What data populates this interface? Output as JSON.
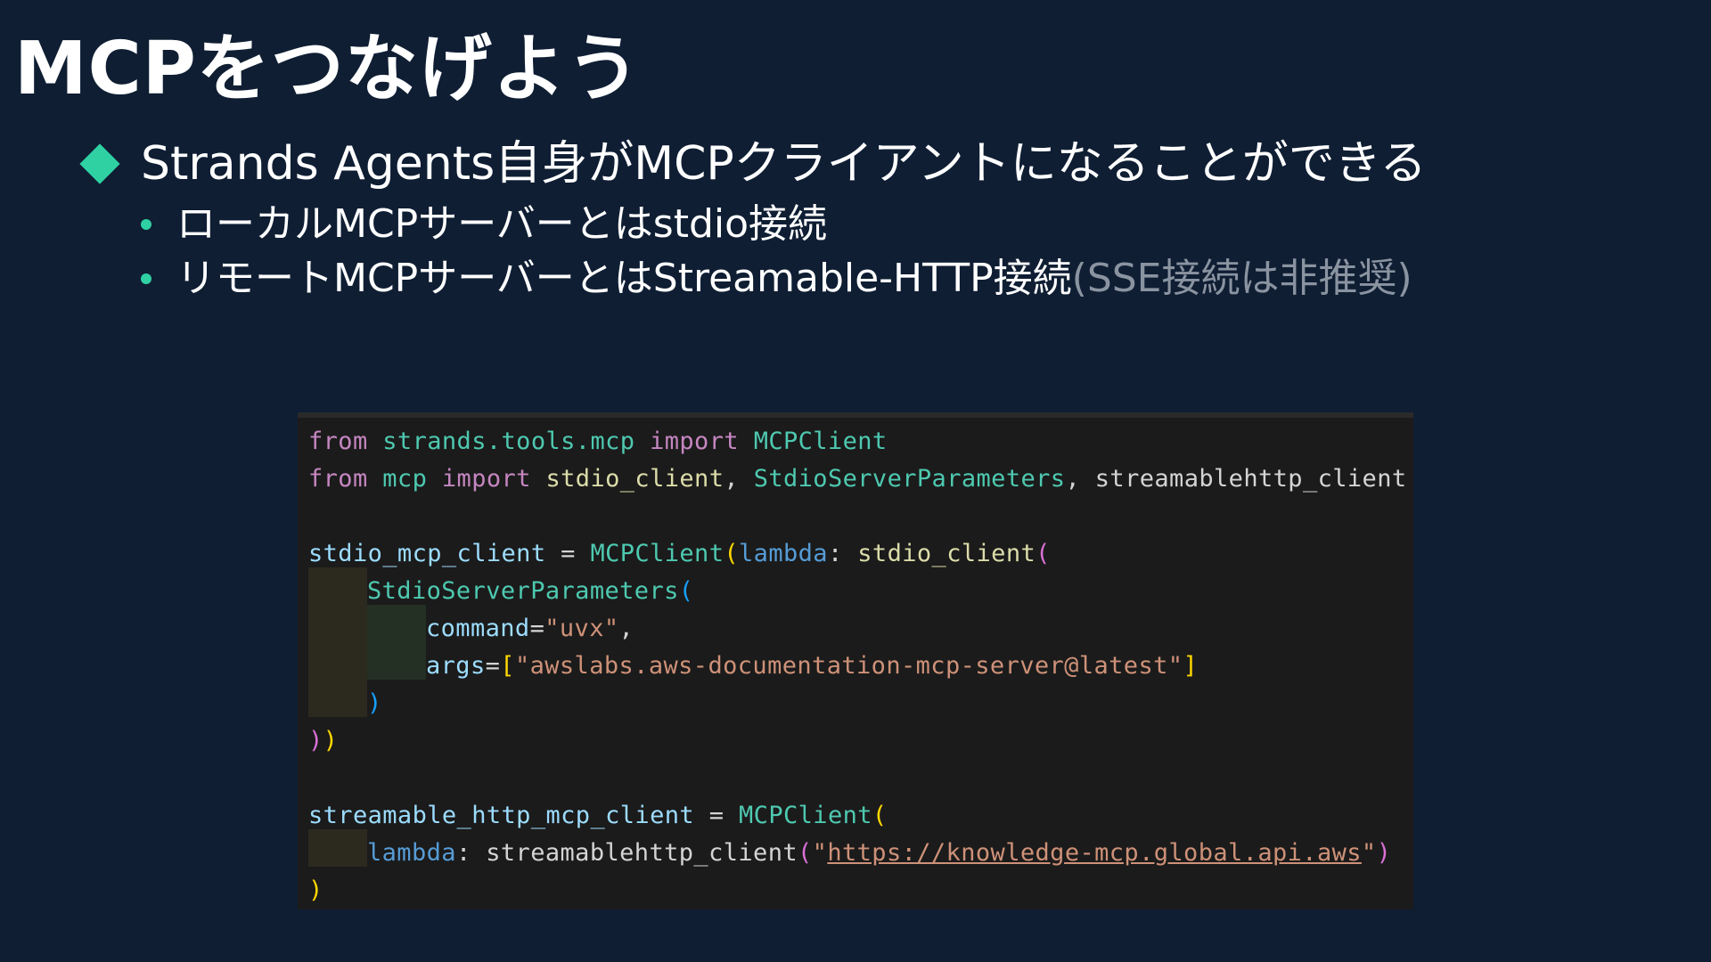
{
  "slide": {
    "title": "MCPをつなげよう",
    "bullet_main": "Strands Agents自身がMCPクライアントになることができる",
    "bullet_sub_1": "ローカルMCPサーバーとはstdio接続",
    "bullet_sub_2": "リモートMCPサーバーとはStreamable-HTTP接続",
    "bullet_sub_2_note": "(SSE接続は非推奨)"
  },
  "code": {
    "l1": {
      "t1": "from",
      "t2": " ",
      "t3": "strands.tools.mcp",
      "t4": " ",
      "t5": "import",
      "t6": " ",
      "t7": "MCPClient"
    },
    "l2": {
      "t1": "from",
      "t2": " ",
      "t3": "mcp",
      "t4": " ",
      "t5": "import",
      "t6": " ",
      "t7": "stdio_client",
      "t8": ", ",
      "t9": "StdioServerParameters",
      "t10": ", ",
      "t11": "streamablehttp_client"
    },
    "l3": {
      "t1": "stdio_mcp_client",
      "t2": " = ",
      "t3": "MCPClient",
      "t4": "(",
      "t5": "lambda",
      "t6": ": ",
      "t7": "stdio_client",
      "t8": "("
    },
    "l4": {
      "t1": "StdioServerParameters",
      "t2": "("
    },
    "l5": {
      "t1": "command",
      "t2": "=",
      "t3": "\"uvx\"",
      "t4": ","
    },
    "l6": {
      "t1": "args",
      "t2": "=",
      "t3": "[",
      "t4": "\"awslabs.aws-documentation-mcp-server@latest\"",
      "t5": "]"
    },
    "l7": {
      "t1": ")"
    },
    "l8": {
      "t1": ")",
      "t2": ")"
    },
    "l9": {
      "t1": "streamable_http_mcp_client",
      "t2": " = ",
      "t3": "MCPClient",
      "t4": "("
    },
    "l10": {
      "t1": "lambda",
      "t2": ": ",
      "t3": "streamablehttp_client",
      "t4": "(",
      "t5": "\"",
      "t6": "https://knowledge-mcp.global.api.aws",
      "t7": "\"",
      "t8": ")"
    },
    "l11": {
      "t1": ")"
    }
  }
}
